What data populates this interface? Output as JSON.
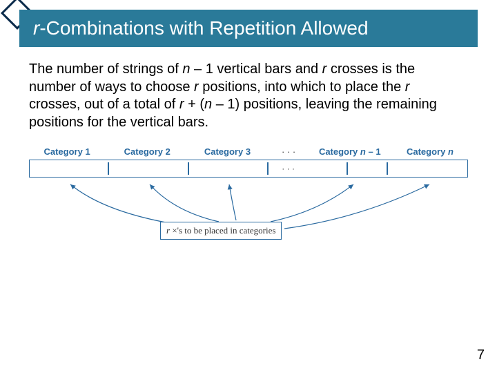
{
  "title": {
    "prefix_italic": "r",
    "rest": "-Combinations with Repetition Allowed"
  },
  "paragraph": {
    "t1": "The number of strings of ",
    "n1": "n",
    "t2": " – 1 vertical bars and ",
    "r1": "r",
    "t3": " crosses is the number of ways to choose ",
    "r2": "r",
    "t4": " positions, into which to place the ",
    "r3": "r",
    "t5": " crosses, out of a total of ",
    "r4": "r",
    "t6": " + (",
    "n2": "n",
    "t7": " – 1) positions, leaving the remaining positions for the vertical bars."
  },
  "diagram": {
    "categories": {
      "c1": "Category 1",
      "c2": "Category 2",
      "c3": "Category 3",
      "dots": "· · ·",
      "cn1_a": "Category ",
      "cn1_b": "n",
      "cn1_c": " – 1",
      "cn_a": "Category ",
      "cn_b": "n"
    },
    "bar_dots": "· · ·",
    "caption": {
      "r": "r",
      "rest": " ×'s to be placed in categories"
    }
  },
  "page": "7"
}
